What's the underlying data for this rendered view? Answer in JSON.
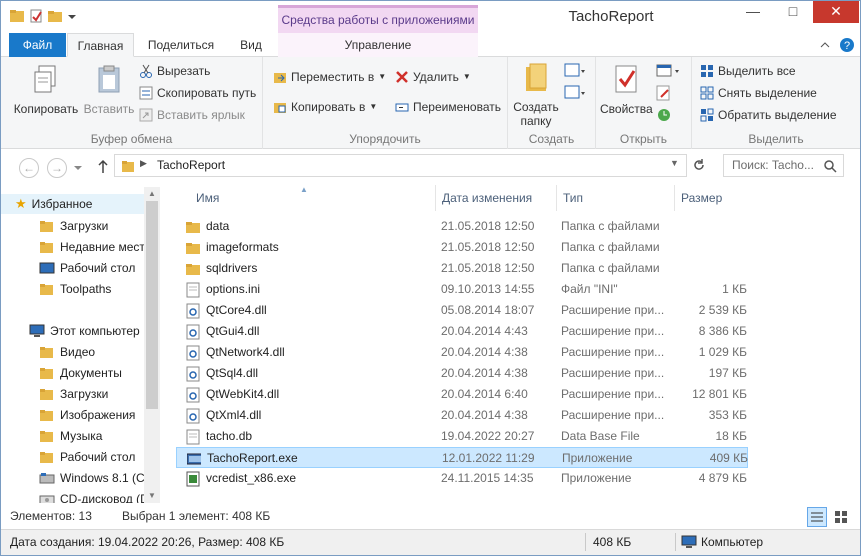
{
  "window": {
    "title": "TachoReport",
    "context_tab": "Средства работы с приложениями"
  },
  "tabs": {
    "file": "Файл",
    "home": "Главная",
    "share": "Поделиться",
    "view": "Вид",
    "manage": "Управление"
  },
  "ribbon": {
    "clipboard": {
      "label": "Буфер обмена",
      "copy": "Копировать",
      "paste": "Вставить",
      "cut": "Вырезать",
      "copy_path": "Скопировать путь",
      "paste_shortcut": "Вставить ярлык"
    },
    "organize": {
      "label": "Упорядочить",
      "move_to": "Переместить в",
      "copy_to": "Копировать в",
      "delete": "Удалить",
      "rename": "Переименовать"
    },
    "create": {
      "label": "Создать",
      "new_folder_1": "Создать",
      "new_folder_2": "папку"
    },
    "open": {
      "label": "Открыть",
      "properties": "Свойства"
    },
    "select": {
      "label": "Выделить",
      "select_all": "Выделить все",
      "select_none": "Снять выделение",
      "invert": "Обратить выделение"
    }
  },
  "address": {
    "path": "TachoReport",
    "search_placeholder": "Поиск: Tacho..."
  },
  "nav": {
    "favorites": "Избранное",
    "fav_items": [
      "Загрузки",
      "Недавние мест",
      "Рабочий стол",
      "Toolpaths"
    ],
    "computer": "Этот компьютер",
    "pc_items": [
      "Видео",
      "Документы",
      "Загрузки",
      "Изображения",
      "Музыка",
      "Рабочий стол",
      "Windows 8.1 (C:",
      "CD-дисковод (D"
    ]
  },
  "columns": {
    "name": "Имя",
    "date": "Дата изменения",
    "type": "Тип",
    "size": "Размер"
  },
  "files": [
    {
      "name": "data",
      "date": "21.05.2018 12:50",
      "type": "Папка с файлами",
      "size": "",
      "kind": "folder"
    },
    {
      "name": "imageformats",
      "date": "21.05.2018 12:50",
      "type": "Папка с файлами",
      "size": "",
      "kind": "folder"
    },
    {
      "name": "sqldrivers",
      "date": "21.05.2018 12:50",
      "type": "Папка с файлами",
      "size": "",
      "kind": "folder"
    },
    {
      "name": "options.ini",
      "date": "09.10.2013 14:55",
      "type": "Файл \"INI\"",
      "size": "1 КБ",
      "kind": "file"
    },
    {
      "name": "QtCore4.dll",
      "date": "05.08.2014 18:07",
      "type": "Расширение при...",
      "size": "2 539 КБ",
      "kind": "dll"
    },
    {
      "name": "QtGui4.dll",
      "date": "20.04.2014 4:43",
      "type": "Расширение при...",
      "size": "8 386 КБ",
      "kind": "dll"
    },
    {
      "name": "QtNetwork4.dll",
      "date": "20.04.2014 4:38",
      "type": "Расширение при...",
      "size": "1 029 КБ",
      "kind": "dll"
    },
    {
      "name": "QtSql4.dll",
      "date": "20.04.2014 4:38",
      "type": "Расширение при...",
      "size": "197 КБ",
      "kind": "dll"
    },
    {
      "name": "QtWebKit4.dll",
      "date": "20.04.2014 6:40",
      "type": "Расширение при...",
      "size": "12 801 КБ",
      "kind": "dll"
    },
    {
      "name": "QtXml4.dll",
      "date": "20.04.2014 4:38",
      "type": "Расширение при...",
      "size": "353 КБ",
      "kind": "dll"
    },
    {
      "name": "tacho.db",
      "date": "19.04.2022 20:27",
      "type": "Data Base File",
      "size": "18 КБ",
      "kind": "file"
    },
    {
      "name": "TachoReport.exe",
      "date": "12.01.2022 11:29",
      "type": "Приложение",
      "size": "409 КБ",
      "kind": "exe",
      "selected": true
    },
    {
      "name": "vcredist_x86.exe",
      "date": "24.11.2015 14:35",
      "type": "Приложение",
      "size": "4 879 КБ",
      "kind": "setup"
    }
  ],
  "status": {
    "items": "Элементов: 13",
    "selected": "Выбран 1 элемент: 408 КБ",
    "details": "Дата создания: 19.04.2022 20:26, Размер: 408 КБ",
    "size": "408 КБ",
    "location": "Компьютер"
  },
  "colors": {
    "accent": "#1979ca",
    "selection": "#cce8ff",
    "context": "#f2d8f2",
    "close": "#c7382d"
  }
}
